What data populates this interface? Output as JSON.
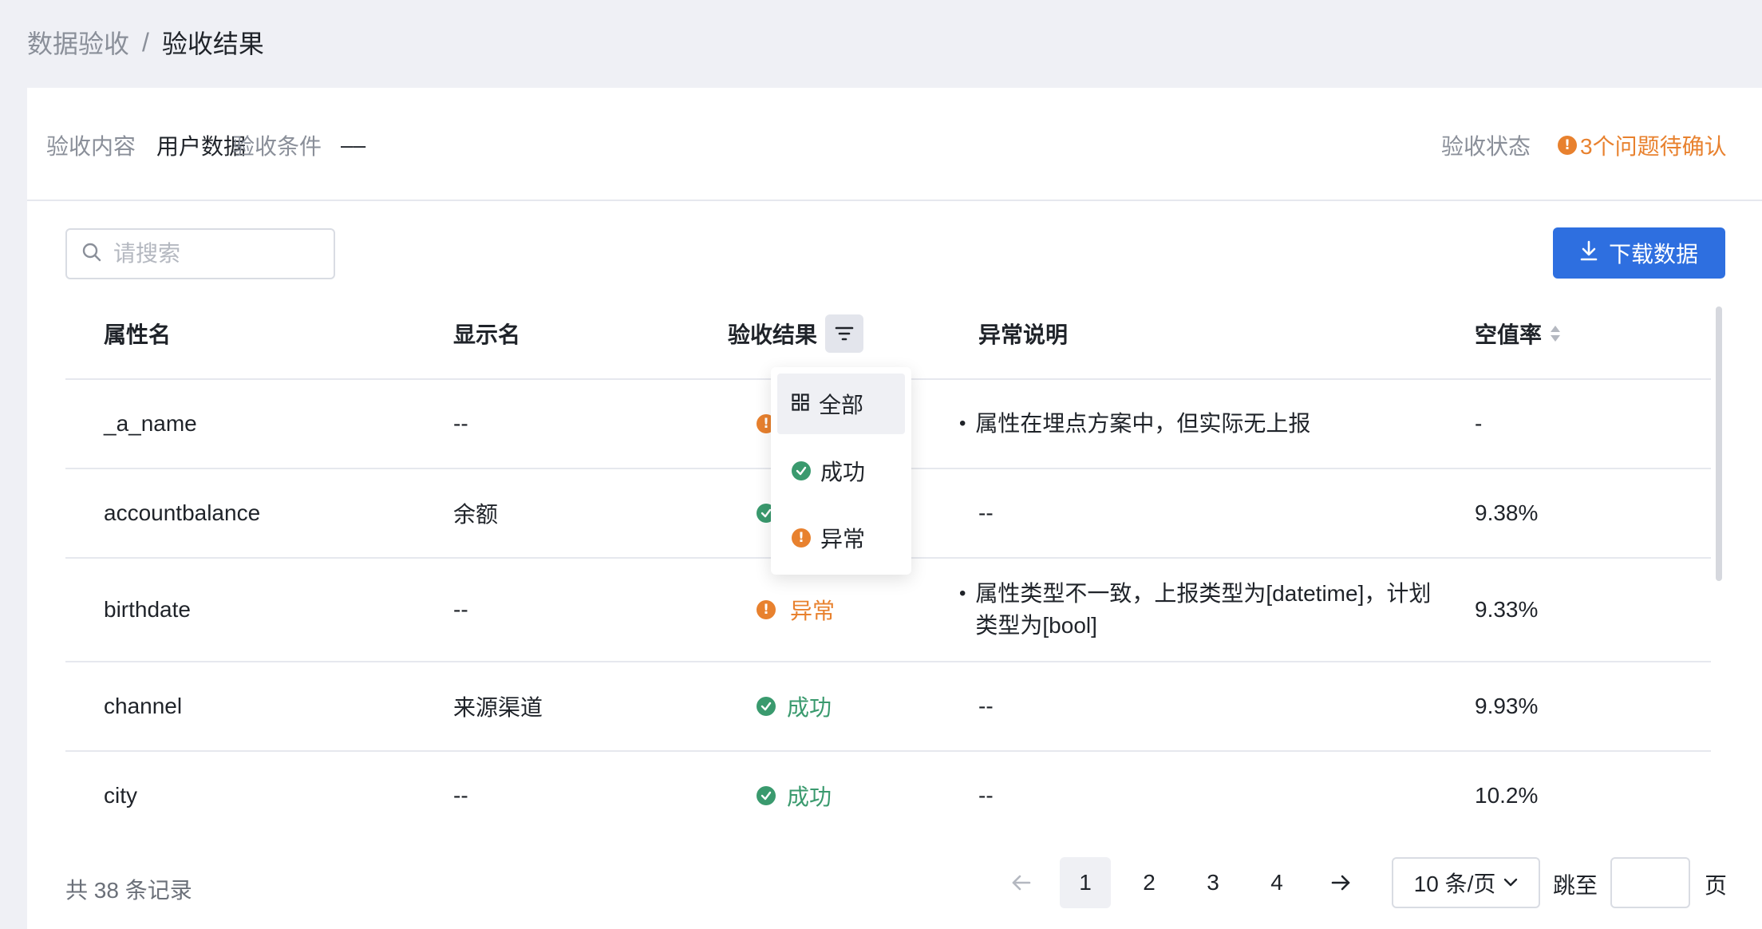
{
  "breadcrumb": {
    "parent": "数据验收",
    "separator": "/",
    "current": "验收结果"
  },
  "info": {
    "content_label": "验收内容",
    "content_value": "用户数据",
    "condition_label": "验收条件",
    "condition_value": "––",
    "status_label": "验收状态",
    "status_value": "3个问题待确认"
  },
  "search": {
    "placeholder": "请搜索"
  },
  "toolbar": {
    "download_label": "下载数据"
  },
  "table": {
    "columns": [
      "属性名",
      "显示名",
      "验收结果",
      "异常说明",
      "空值率"
    ],
    "rows": [
      {
        "name": "_a_name",
        "display": "--",
        "result": "异常",
        "status": "fail",
        "note": "属性在埋点方案中，但实际无上报",
        "null_rate": "-"
      },
      {
        "name": "accountbalance",
        "display": "余额",
        "result": "成功",
        "status": "ok",
        "note": "--",
        "null_rate": "9.38%"
      },
      {
        "name": "birthdate",
        "display": "--",
        "result": "异常",
        "status": "fail",
        "note": "属性类型不一致，上报类型为[datetime]，计划类型为[bool]",
        "null_rate": "9.33%"
      },
      {
        "name": "channel",
        "display": "来源渠道",
        "result": "成功",
        "status": "ok",
        "note": "--",
        "null_rate": "9.93%"
      },
      {
        "name": "city",
        "display": "--",
        "result": "成功",
        "status": "ok",
        "note": "--",
        "null_rate": "10.2%"
      }
    ]
  },
  "filter_dropdown": {
    "options": [
      "全部",
      "成功",
      "异常"
    ],
    "selected": "全部"
  },
  "footer": {
    "total": "共 38 条记录",
    "pages": [
      "1",
      "2",
      "3",
      "4"
    ],
    "current_page": "1",
    "page_size": "10 条/页",
    "jump_label": "跳至",
    "page_suffix": "页"
  },
  "colors": {
    "accent": "#2e6fe0",
    "warning": "#e8812e",
    "success": "#3a9a6e"
  }
}
